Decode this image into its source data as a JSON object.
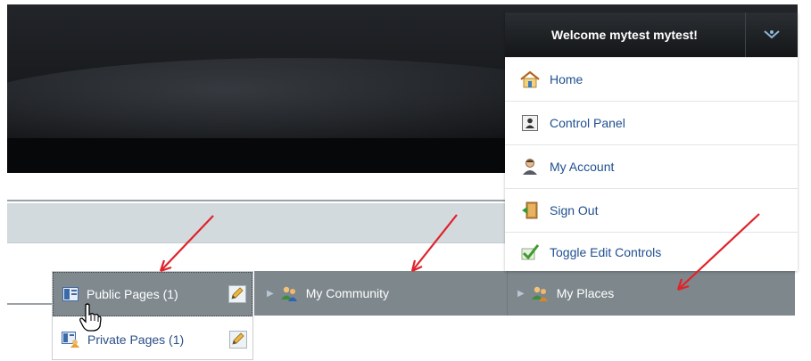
{
  "dock": {
    "welcome": "Welcome mytest mytest!",
    "items": [
      {
        "label": "Home",
        "icon": "home-icon"
      },
      {
        "label": "Control Panel",
        "icon": "control-panel-icon"
      },
      {
        "label": "My Account",
        "icon": "user-icon"
      },
      {
        "label": "Sign Out",
        "icon": "sign-out-icon"
      },
      {
        "label": "Toggle Edit Controls",
        "icon": "checkmark-icon"
      }
    ]
  },
  "nav": {
    "public_pages": "Public Pages (1)",
    "private_pages": "Private Pages (1)",
    "my_community": "My Community",
    "my_places": "My Places"
  },
  "colors": {
    "banner": "#17191c",
    "navbar": "#7d878c",
    "link": "#1f4f8f",
    "annotation_arrow": "#e0222a"
  }
}
